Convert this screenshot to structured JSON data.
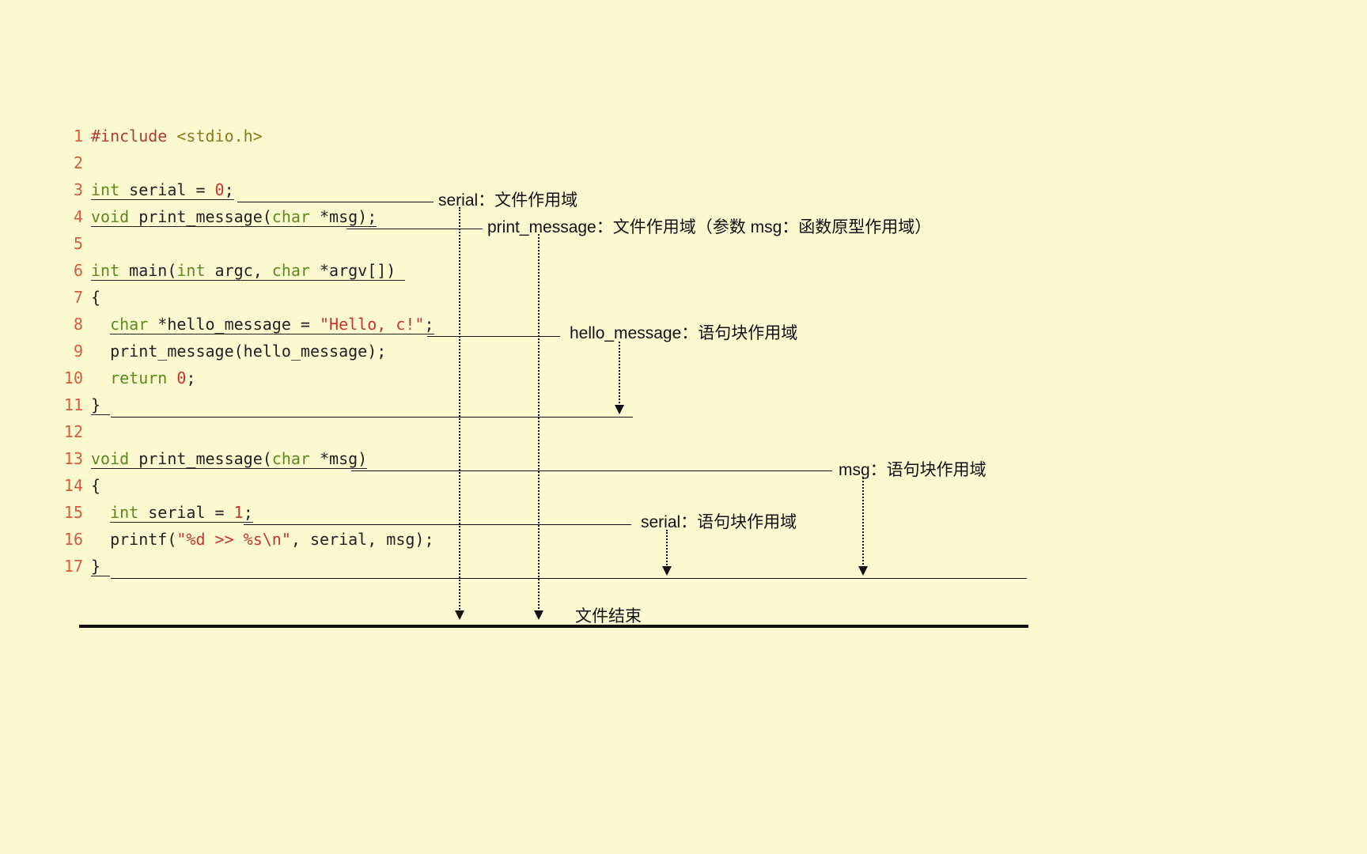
{
  "code": {
    "lines": [
      {
        "n": "1",
        "html": "<span class='preproc'>#include</span> <span class='preproc-arg'>&lt;stdio.h&gt;</span>"
      },
      {
        "n": "2",
        "html": ""
      },
      {
        "n": "3",
        "html": "<span class='ul'><span class='kw-green'>int</span> serial = <span class='num'>0</span>;</span>"
      },
      {
        "n": "4",
        "html": "<span class='ul'><span class='kw-green'>void</span> print_message(<span class='kw-green'>char</span> *msg);</span>"
      },
      {
        "n": "5",
        "html": ""
      },
      {
        "n": "6",
        "html": "<span class='ul'><span class='kw-green'>int</span> main(<span class='kw-green'>int</span> argc, <span class='kw-green'>char</span> *argv[]) </span>"
      },
      {
        "n": "7",
        "html": "{"
      },
      {
        "n": "8",
        "html": "  <span class='ul'><span class='kw-green'>char</span> *hello_message = <span class='str'>\"Hello, c!\"</span>;</span>"
      },
      {
        "n": "9",
        "html": "  print_message(hello_message);"
      },
      {
        "n": "10",
        "html": "  <span class='kw-green'>return</span> <span class='num'>0</span>;"
      },
      {
        "n": "11",
        "html": "<span class='ul'>} </span>"
      },
      {
        "n": "12",
        "html": ""
      },
      {
        "n": "13",
        "html": "<span class='ul'><span class='kw-green'>void</span> print_message(<span class='kw-green'>char</span> *msg)</span>"
      },
      {
        "n": "14",
        "html": "{"
      },
      {
        "n": "15",
        "html": "  <span class='ul'><span class='kw-green'>int</span> serial = <span class='num'>1</span>;</span>"
      },
      {
        "n": "16",
        "html": "  printf(<span class='str'>\"%d &gt;&gt; %s\\n\"</span>, serial, msg);"
      },
      {
        "n": "17",
        "html": "<span class='ul'>} </span>"
      }
    ]
  },
  "annotations": {
    "serial_file": "serial：文件作用域",
    "print_message_file": "print_message：文件作用域（参数 msg：函数原型作用域）",
    "hello_message_block": "hello_message：语句块作用域",
    "msg_block": "msg：语句块作用域",
    "serial_block": "serial：语句块作用域",
    "file_end": "文件结束"
  }
}
